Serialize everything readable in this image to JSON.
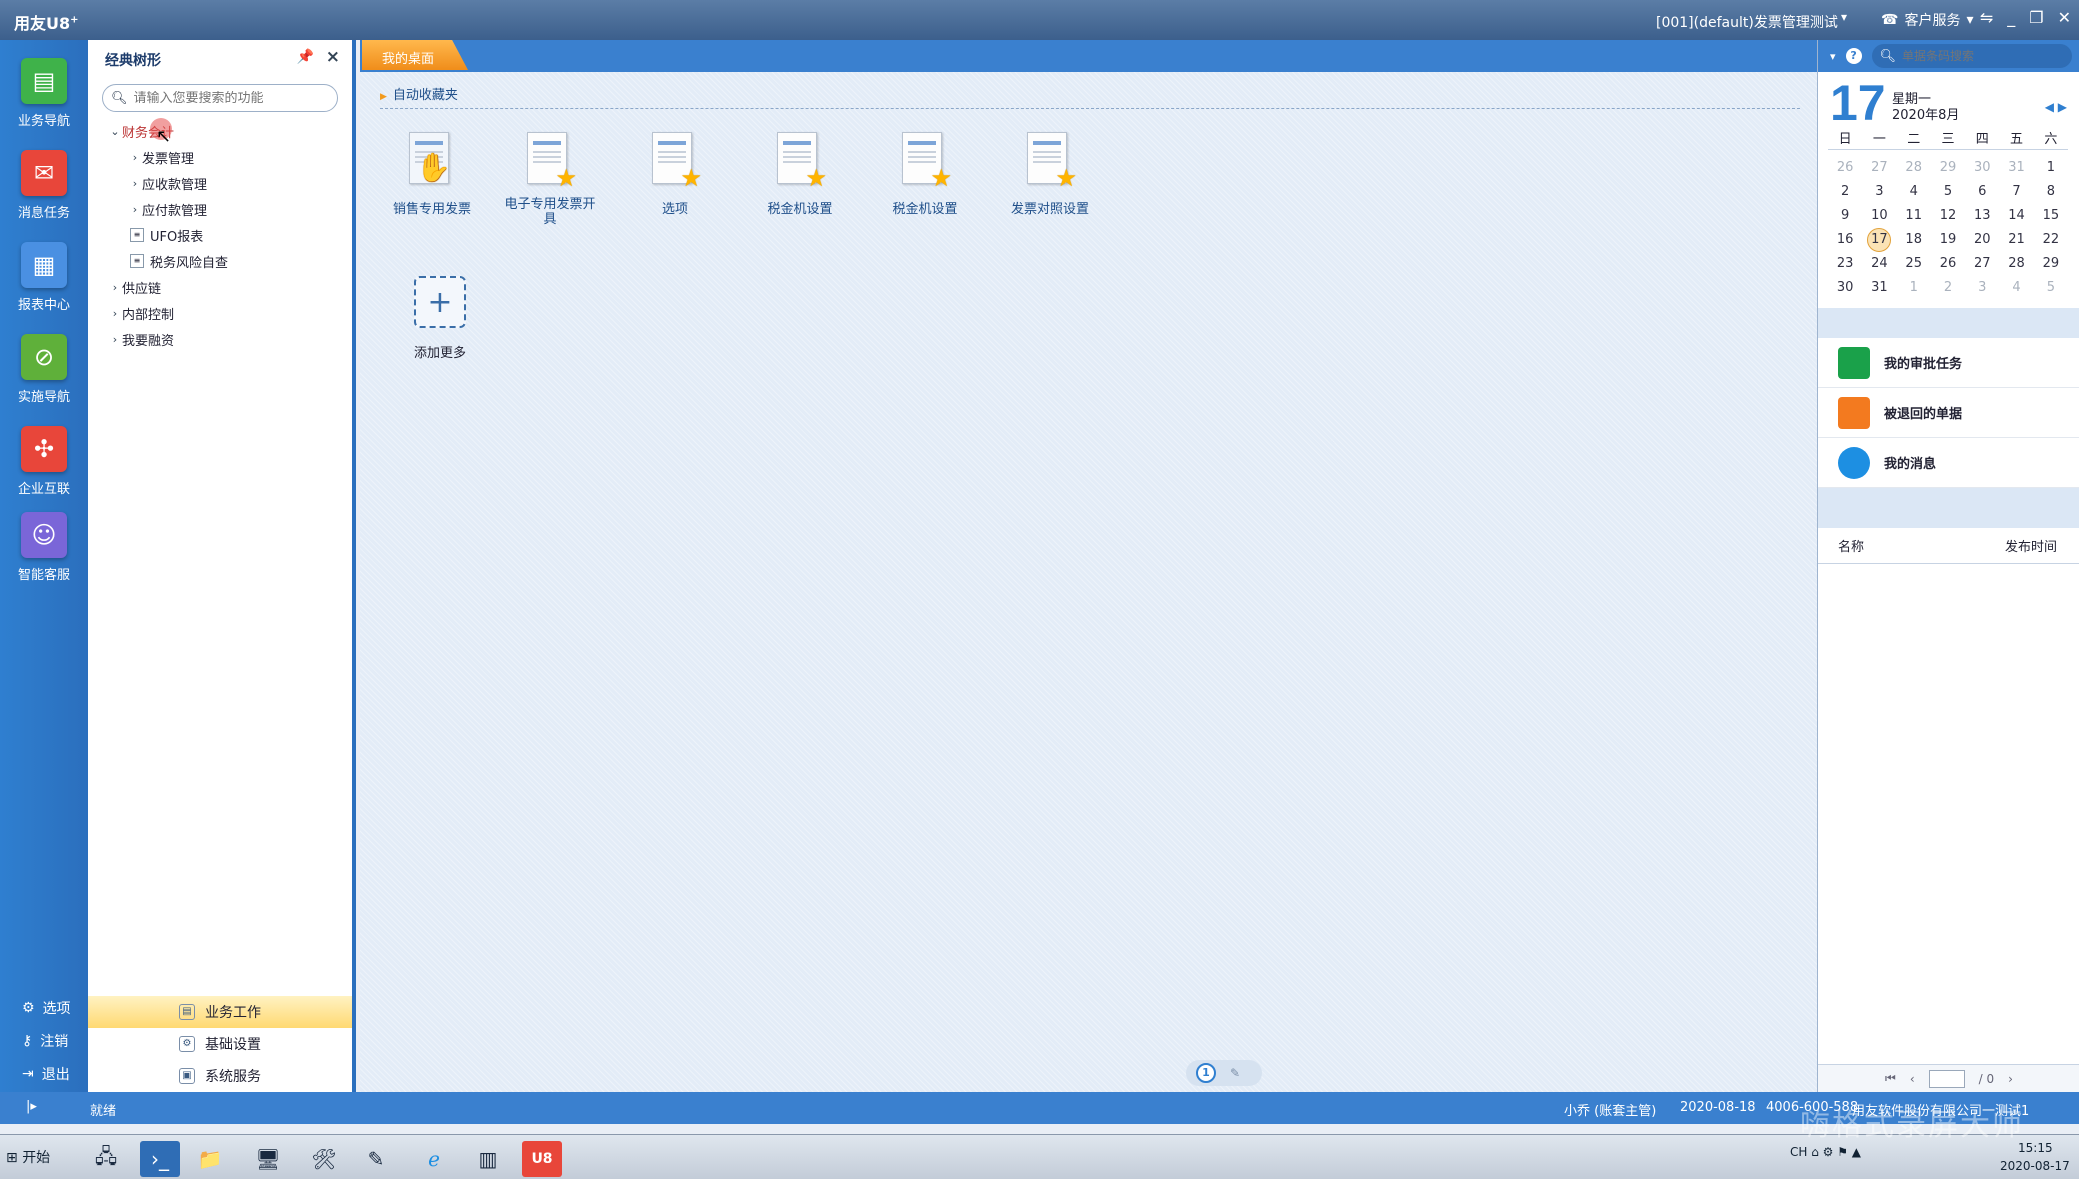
{
  "titlebar": {
    "app_name": "用友U8",
    "app_sup": "+",
    "context": "[001](default)发票管理测试",
    "customer_service": "客户服务",
    "controls": [
      "⇋",
      "_",
      "❐",
      "✕"
    ]
  },
  "leftnav": {
    "items": [
      {
        "label": "业务导航",
        "icon": "business-nav-icon",
        "color": "#3fb24a"
      },
      {
        "label": "消息任务",
        "icon": "message-task-icon",
        "color": "#e8463a"
      },
      {
        "label": "报表中心",
        "icon": "report-center-icon",
        "color": "#4a90e2"
      },
      {
        "label": "实施导航",
        "icon": "implement-nav-icon",
        "color": "#5fb03a"
      },
      {
        "label": "企业互联",
        "icon": "enterprise-connect-icon",
        "color": "#e8463a"
      },
      {
        "label": "智能客服",
        "icon": "smart-service-icon",
        "color": "#7a66d8"
      }
    ],
    "bottom": {
      "options": "选项",
      "logout": "注销",
      "exit": "退出"
    }
  },
  "tree": {
    "title": "经典树形",
    "search_placeholder": "请输入您要搜索的功能",
    "nodes": [
      {
        "label": "财务会计",
        "level": 0,
        "type": "open"
      },
      {
        "label": "发票管理",
        "level": 1,
        "type": "closed"
      },
      {
        "label": "应收款管理",
        "level": 1,
        "type": "closed"
      },
      {
        "label": "应付款管理",
        "level": 1,
        "type": "closed"
      },
      {
        "label": "UFO报表",
        "level": 1,
        "type": "doc"
      },
      {
        "label": "税务风险自查",
        "level": 1,
        "type": "doc"
      },
      {
        "label": "供应链",
        "level": 0,
        "type": "closed"
      },
      {
        "label": "内部控制",
        "level": 0,
        "type": "closed"
      },
      {
        "label": "我要融资",
        "level": 0,
        "type": "closed"
      }
    ],
    "bottom_tabs": {
      "business": "业务工作",
      "basic": "基础设置",
      "system": "系统服务"
    }
  },
  "main": {
    "tab": "我的桌面",
    "favorites_title": "自动收藏夹",
    "favorites": [
      "销售专用发票",
      "电子专用发票开具",
      "选项",
      "税金机设置",
      "税金机设置",
      "发票对照设置"
    ],
    "add_more": "添加更多",
    "page": "1"
  },
  "right": {
    "search_placeholder": "单据条码搜索",
    "calendar": {
      "day": "17",
      "weekday": "星期一",
      "month": "2020年8月",
      "weekdays": [
        "日",
        "一",
        "二",
        "三",
        "四",
        "五",
        "六"
      ],
      "days": [
        "26",
        "27",
        "28",
        "29",
        "30",
        "31",
        "1",
        "2",
        "3",
        "4",
        "5",
        "6",
        "7",
        "8",
        "9",
        "10",
        "11",
        "12",
        "13",
        "14",
        "15",
        "16",
        "17",
        "18",
        "19",
        "20",
        "21",
        "22",
        "23",
        "24",
        "25",
        "26",
        "27",
        "28",
        "29",
        "30",
        "31",
        "1",
        "2",
        "3",
        "4",
        "5"
      ],
      "other_month_indices": [
        0,
        1,
        2,
        3,
        4,
        5,
        37,
        38,
        39,
        40,
        41
      ],
      "today_index": 22
    },
    "tasks": [
      {
        "label": "我的审批任务",
        "color": "#1aa14a"
      },
      {
        "label": "被退回的单据",
        "color": "#f37a1f"
      },
      {
        "label": "我的消息",
        "color": "#1d8fe2"
      }
    ],
    "news_cols": {
      "name": "名称",
      "time": "发布时间"
    },
    "pager_total": "/ 0"
  },
  "status": {
    "ready": "就绪",
    "user": "小乔 (账套主管)",
    "date": "2020-08-18",
    "phone": "4006-600-588",
    "company": "用友软件股份有限公司一测试1"
  },
  "taskbar": {
    "start": "开始",
    "tray": "CH",
    "time": "15:15",
    "date": "2020-08-17",
    "watermark": "嗨格式录屏大师"
  }
}
